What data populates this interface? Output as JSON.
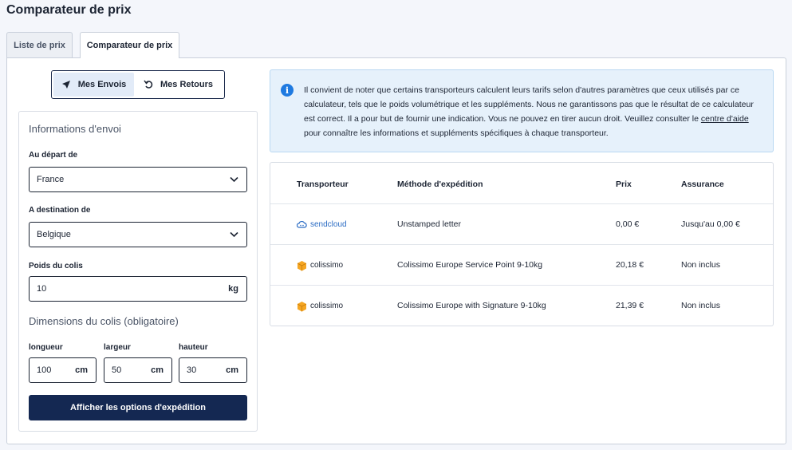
{
  "page": {
    "title": "Comparateur de prix"
  },
  "tabs": [
    {
      "label": "Liste de prix",
      "active": false
    },
    {
      "label": "Comparateur de prix",
      "active": true
    }
  ],
  "toggle": {
    "send_label": "Mes Envois",
    "send_icon": "paper-plane-icon",
    "return_label": "Mes Retours",
    "return_icon": "undo-arrow-icon",
    "selected": "Mes Envois"
  },
  "form": {
    "shipping_heading": "Informations d'envoi",
    "from_label": "Au départ de",
    "from_value": "France",
    "to_label": "A destination de",
    "to_value": "Belgique",
    "weight_label": "Poids du colis",
    "weight_value": "10",
    "weight_unit": "kg",
    "dimensions_heading": "Dimensions du colis (obligatoire)",
    "length_label": "longueur",
    "length_value": "100",
    "width_label": "largeur",
    "width_value": "50",
    "height_label": "hauteur",
    "height_value": "30",
    "dim_unit": "cm",
    "submit_label": "Afficher les options d'expédition"
  },
  "notice": {
    "text_before": "Il convient de noter que certains transporteurs calculent leurs tarifs selon d'autres paramètres que ceux utilisés par ce calculateur, tels que le poids volumétrique et les suppléments. Nous ne garantissons pas que le résultat de ce calculateur est correct. Il a pour but de fournir une indication. Vous ne pouvez en tirer aucun droit. Veuillez consulter le ",
    "link_text": "centre d'aide",
    "text_after": " pour connaître les informations et suppléments spécifiques à chaque transporteur.",
    "accent_color": "#1f7ae0"
  },
  "results": {
    "headers": {
      "carrier": "Transporteur",
      "method": "Méthode d'expédition",
      "price": "Prix",
      "insurance": "Assurance"
    },
    "rows": [
      {
        "carrier": "sendcloud",
        "carrier_icon": "sendcloud-cloud-icon",
        "method": "Unstamped letter",
        "price": "0,00 €",
        "insurance": "Jusqu'au 0,00 €"
      },
      {
        "carrier": "colissimo",
        "carrier_icon": "colissimo-box-icon",
        "method": "Colissimo Europe Service Point 9-10kg",
        "price": "20,18 €",
        "insurance": "Non inclus"
      },
      {
        "carrier": "colissimo",
        "carrier_icon": "colissimo-box-icon",
        "method": "Colissimo Europe with Signature 9-10kg",
        "price": "21,39 €",
        "insurance": "Non inclus"
      }
    ]
  },
  "colors": {
    "primary": "#142852",
    "brand_orange": "#f5a623",
    "sendcloud_blue": "#2b6cc4"
  }
}
